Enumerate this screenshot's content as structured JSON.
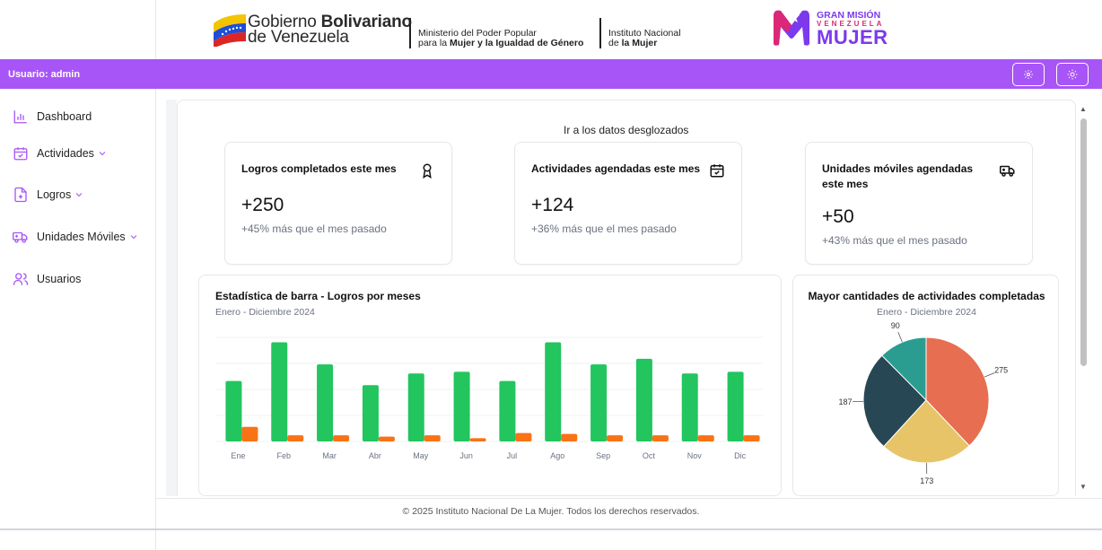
{
  "header": {
    "gov_line1_a": "Gobierno ",
    "gov_line1_b": "Bolivariano",
    "gov_line2": "de Venezuela",
    "ministry_line1": "Ministerio del Poder Popular",
    "ministry_line2_a": "para la ",
    "ministry_line2_b": "Mujer y la Igualdad de Género",
    "institute_line1": "Instituto Nacional",
    "institute_line2_a": "de ",
    "institute_line2_b": "la Mujer",
    "mision_line1": "GRAN MISIÓN",
    "mision_line2": "VENEZUELA",
    "mision_line3": "MUJER"
  },
  "userbar": {
    "label": "Usuario: admin",
    "settings_icon": "gear-icon",
    "theme_icon": "sun-icon"
  },
  "sidebar": {
    "items": [
      {
        "label": "Dashboard",
        "icon": "bar-chart-icon"
      },
      {
        "label": "Actividades",
        "icon": "calendar-check-icon"
      },
      {
        "label": "Logros",
        "icon": "file-plus-icon"
      },
      {
        "label": "Unidades Móviles",
        "icon": "truck-icon"
      },
      {
        "label": "Usuarios",
        "icon": "users-icon"
      }
    ]
  },
  "main": {
    "link": "Ir a los datos desglozados",
    "cards": [
      {
        "title": "Logros completados este mes",
        "value": "+250",
        "sub": "+45% más que el mes pasado",
        "icon": "award-icon"
      },
      {
        "title": "Actividades agendadas este mes",
        "value": "+124",
        "sub": "+36% más que el mes pasado",
        "icon": "calendar-check-icon"
      },
      {
        "title": "Unidades móviles agendadas este mes",
        "value": "+50",
        "sub": "+43% más que el mes pasado",
        "icon": "truck-icon"
      }
    ]
  },
  "chart_data": [
    {
      "type": "bar",
      "title": "Estadística de barra - Logros por meses",
      "subtitle": "Enero - Diciembre 2024",
      "categories": [
        "Ene",
        "Feb",
        "Mar",
        "Abr",
        "May",
        "Jun",
        "Jul",
        "Ago",
        "Sep",
        "Oct",
        "Nov",
        "Dic"
      ],
      "series": [
        {
          "color": "#22c55e",
          "values": [
            186,
            305,
            237,
            173,
            209,
            214,
            186,
            305,
            237,
            254,
            209,
            214
          ]
        },
        {
          "color": "#f97316",
          "values": [
            45,
            19,
            19,
            15,
            19,
            10,
            26,
            23,
            19,
            19,
            19,
            19
          ]
        }
      ],
      "ylim": [
        0,
        320
      ],
      "grid": true
    },
    {
      "type": "pie",
      "title": "Mayor cantidades de actividades completadas",
      "subtitle": "Enero - Diciembre 2024",
      "slices": [
        {
          "value": 275,
          "label": "275",
          "color": "#e76e50"
        },
        {
          "value": 173,
          "label": "173",
          "color": "#e8c468"
        },
        {
          "value": 187,
          "label": "187",
          "color": "#274754"
        },
        {
          "value": 90,
          "label": "90",
          "color": "#2a9d90"
        }
      ]
    }
  ],
  "footer": {
    "text": "© 2025 Instituto Nacional De La Mujer. Todos los derechos reservados."
  }
}
